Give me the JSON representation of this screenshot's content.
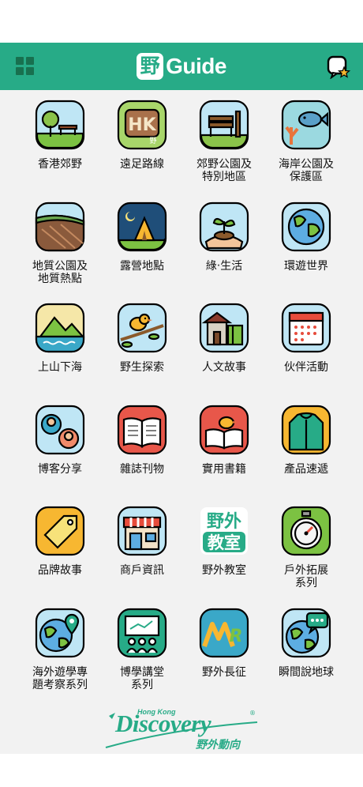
{
  "header": {
    "logo_badge": "野",
    "logo_text": "Guide"
  },
  "tiles": [
    {
      "label": "香港郊野",
      "icon": "tree-bench-icon"
    },
    {
      "label": "遠足路線",
      "icon": "hk-stone-icon"
    },
    {
      "label": "郊野公園及\n特別地區",
      "icon": "park-bench-icon"
    },
    {
      "label": "海岸公園及\n保護區",
      "icon": "fish-coral-icon"
    },
    {
      "label": "地質公園及\n地質熱點",
      "icon": "rock-layers-icon"
    },
    {
      "label": "露營地點",
      "icon": "tent-icon"
    },
    {
      "label": "綠‧生活",
      "icon": "sprout-hand-icon"
    },
    {
      "label": "環遊世界",
      "icon": "globe-icon"
    },
    {
      "label": "上山下海",
      "icon": "mountain-sea-icon"
    },
    {
      "label": "野生探索",
      "icon": "bird-branch-icon"
    },
    {
      "label": "人文故事",
      "icon": "village-house-icon"
    },
    {
      "label": "伙伴活動",
      "icon": "calendar-icon"
    },
    {
      "label": "博客分享",
      "icon": "blogger-chat-icon"
    },
    {
      "label": "雜誌刊物",
      "icon": "open-book-icon"
    },
    {
      "label": "實用書籍",
      "icon": "bird-book-icon"
    },
    {
      "label": "產品速遞",
      "icon": "jacket-icon"
    },
    {
      "label": "品牌故事",
      "icon": "tag-icon"
    },
    {
      "label": "商戶資訊",
      "icon": "shop-icon"
    },
    {
      "label": "野外教室",
      "icon": "outdoor-classroom-icon"
    },
    {
      "label": "戶外拓展\n系列",
      "icon": "stopwatch-icon"
    },
    {
      "label": "海外遊學專\n題考察系列",
      "icon": "globe-pin-icon"
    },
    {
      "label": "博學講堂\n系列",
      "icon": "lecture-icon"
    },
    {
      "label": "野外長征",
      "icon": "mr-logo-icon"
    },
    {
      "label": "瞬間說地球",
      "icon": "globe-chat-icon"
    }
  ],
  "classroom_icon_text": [
    "野外",
    "教室"
  ],
  "hiking_icon_text": [
    "HK",
    "野"
  ],
  "lecture_mr_text": "MR",
  "footer": {
    "hong_kong": "Hong Kong",
    "discovery": "Discovery",
    "chinese": "野外動向",
    "reg": "®"
  },
  "colors": {
    "header": "#27ab87",
    "content_bg": "#f2f2f2",
    "brand_green": "#27ab87"
  }
}
